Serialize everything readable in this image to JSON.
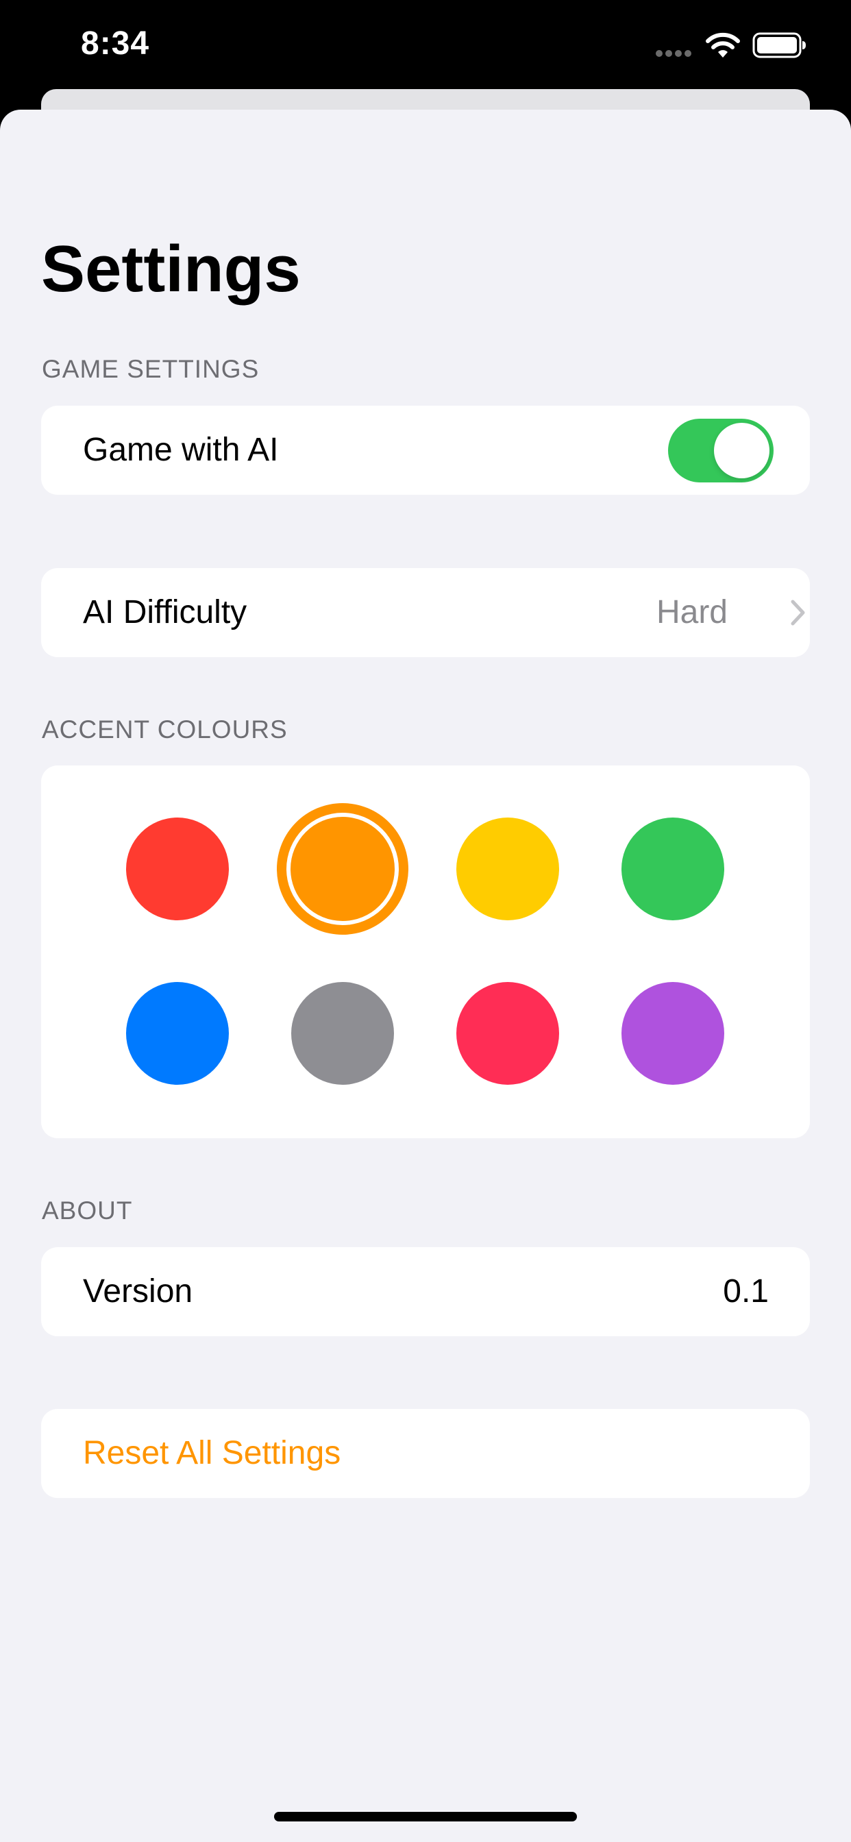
{
  "status_bar": {
    "time": "8:34",
    "icons": [
      "cellular-signal-icon",
      "wifi-icon",
      "battery-icon"
    ]
  },
  "page": {
    "title": "Settings"
  },
  "sections": {
    "game_settings": {
      "header": "GAME SETTINGS",
      "game_with_ai_label": "Game with AI",
      "game_with_ai_enabled": true
    },
    "difficulty": {
      "label": "AI Difficulty",
      "value": "Hard"
    },
    "accent_colours": {
      "header": "ACCENT COLOURS",
      "selected": "orange",
      "colors": [
        {
          "name": "red",
          "hex": "#ff3b30"
        },
        {
          "name": "orange",
          "hex": "#ff9500"
        },
        {
          "name": "yellow",
          "hex": "#ffcc00"
        },
        {
          "name": "green",
          "hex": "#34c759"
        },
        {
          "name": "blue",
          "hex": "#007aff"
        },
        {
          "name": "gray",
          "hex": "#8e8e93"
        },
        {
          "name": "pink",
          "hex": "#ff2d55"
        },
        {
          "name": "purple",
          "hex": "#af52de"
        }
      ]
    },
    "about": {
      "header": "ABOUT",
      "version_label": "Version",
      "version_value": "0.1"
    },
    "reset": {
      "label": "Reset All Settings"
    }
  },
  "colors": {
    "accent": "#ff9500",
    "toggle_on": "#34c759",
    "background": "#f2f2f7",
    "secondary_text": "#6d6d72",
    "value_text": "#8a8a8e"
  }
}
